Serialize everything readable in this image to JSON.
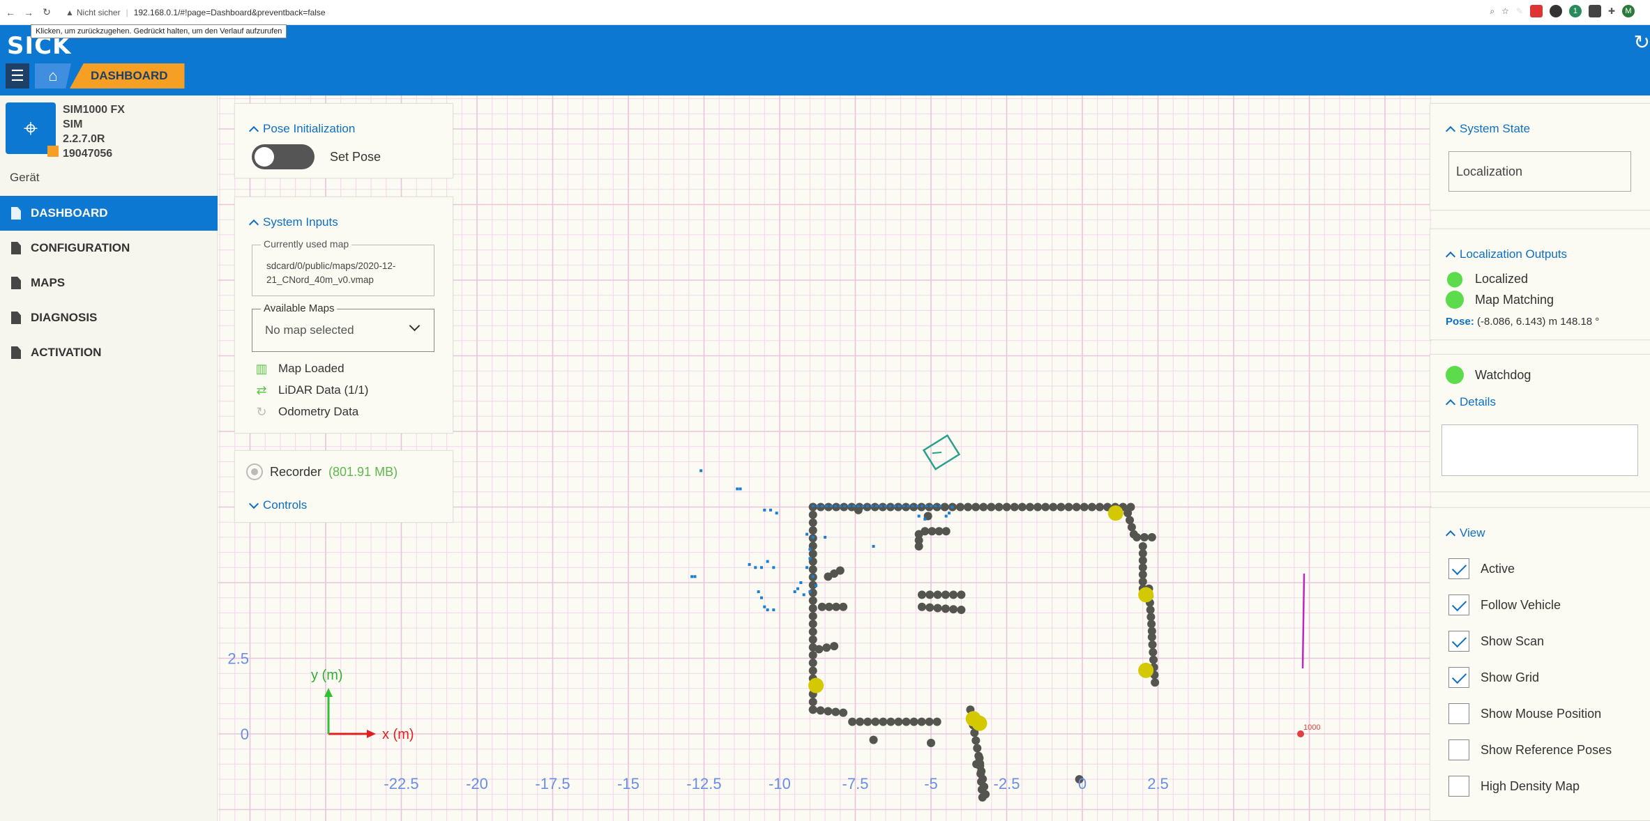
{
  "browser": {
    "back_glyph": "←",
    "forward_glyph": "→",
    "reload_glyph": "↻",
    "security_text": "Nicht sicher",
    "url": "192.168.0.1/#!page=Dashboard&preventback=false",
    "tooltip": "Klicken, um zurückzugehen. Gedrückt halten, um den Verlauf aufzurufen",
    "extension_badge": "1",
    "profile_initial": "M"
  },
  "header": {
    "logo": "SICK",
    "breadcrumb": "DASHBOARD",
    "accent_color": "#0d78d2",
    "crumb_color": "#f5a024"
  },
  "device": {
    "name": "SIM1000 FX",
    "type": "SIM",
    "version": "2.2.7.0R",
    "serial": "19047056"
  },
  "sidebar": {
    "section_label": "Gerät",
    "items": [
      {
        "label": "DASHBOARD",
        "active": true
      },
      {
        "label": "CONFIGURATION",
        "active": false
      },
      {
        "label": "MAPS",
        "active": false
      },
      {
        "label": "DIAGNOSIS",
        "active": false
      },
      {
        "label": "ACTIVATION",
        "active": false
      }
    ]
  },
  "pose_init": {
    "title": "Pose Initialization",
    "toggle_label": "Set Pose",
    "toggle_on": false
  },
  "system_inputs": {
    "title": "System Inputs",
    "current_map_label": "Currently used map",
    "current_map_value": "sdcard/0/public/maps/2020-12-21_CNord_40m_v0.vmap",
    "available_maps_label": "Available Maps",
    "available_maps_value": "No map selected",
    "statuses": [
      {
        "label": "Map Loaded",
        "icon": "map-icon"
      },
      {
        "label": "LiDAR Data (1/1)",
        "icon": "lidar-icon"
      },
      {
        "label": "Odometry Data",
        "icon": "odometry-icon"
      }
    ]
  },
  "recorder": {
    "label": "Recorder",
    "size": "(801.91 MB)",
    "controls_label": "Controls"
  },
  "system_state": {
    "title": "System State",
    "value": "Localization"
  },
  "localization_outputs": {
    "title": "Localization Outputs",
    "localized_label": "Localized",
    "map_matching_label": "Map Matching",
    "pose_label": "Pose:",
    "pose_value": "(-8.086, 6.143) m 148.18 °"
  },
  "watchdog": {
    "label": "Watchdog",
    "details_title": "Details"
  },
  "view": {
    "title": "View",
    "options": [
      {
        "label": "Active",
        "checked": true
      },
      {
        "label": "Follow Vehicle",
        "checked": true
      },
      {
        "label": "Show Scan",
        "checked": true
      },
      {
        "label": "Show Grid",
        "checked": true
      },
      {
        "label": "Show Mouse Position",
        "checked": false
      },
      {
        "label": "Show Reference Poses",
        "checked": false
      },
      {
        "label": "High Density Map",
        "checked": false
      }
    ]
  },
  "map_view": {
    "x_axis_label": "x (m)",
    "y_axis_label": "y (m)",
    "x_ticks": [
      "-22.5",
      "-20",
      "-17.5",
      "-15",
      "-12.5",
      "-10",
      "-7.5",
      "-5",
      "-2.5",
      "0",
      "2.5"
    ],
    "y_ticks": [
      "2.5",
      "0"
    ],
    "origin_marker_label": "1000",
    "obstacle_color": "#555550",
    "scan_color": "#1a7fd4",
    "reference_color": "#d4c800"
  }
}
